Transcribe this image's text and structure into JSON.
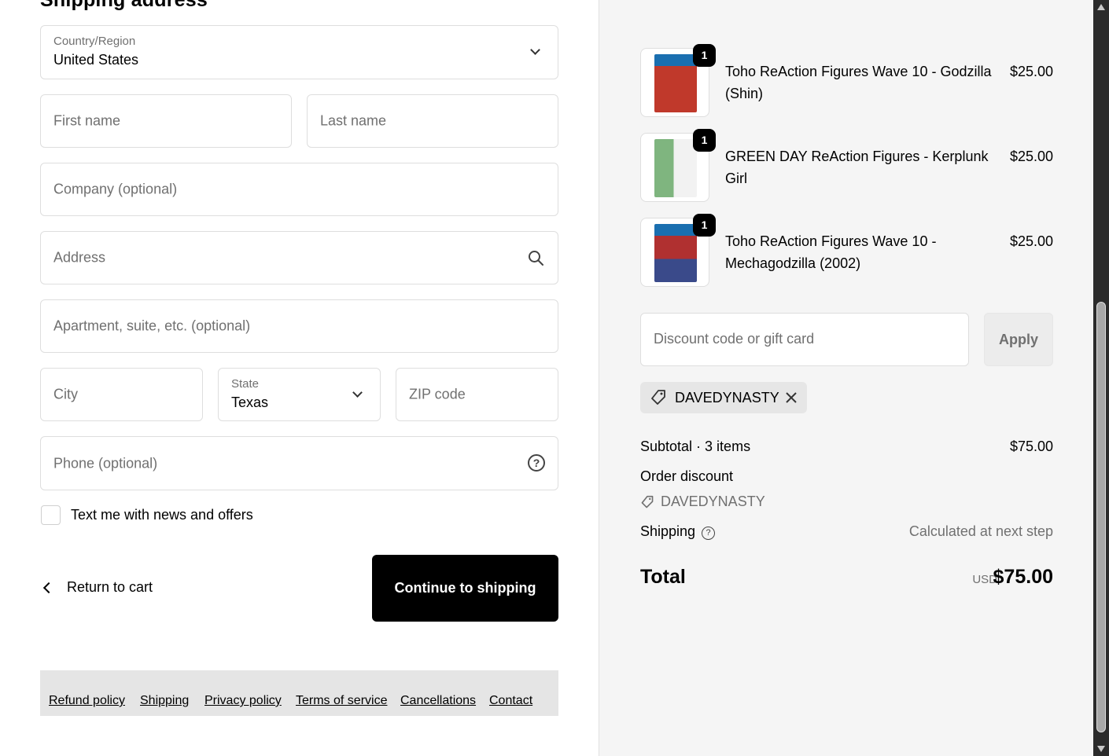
{
  "shipping": {
    "title": "Shipping address",
    "country_label": "Country/Region",
    "country_value": "United States",
    "first_name_placeholder": "First name",
    "last_name_placeholder": "Last name",
    "company_placeholder": "Company (optional)",
    "address_placeholder": "Address",
    "apartment_placeholder": "Apartment, suite, etc. (optional)",
    "city_placeholder": "City",
    "state_label": "State",
    "state_value": "Texas",
    "zip_placeholder": "ZIP code",
    "phone_placeholder": "Phone (optional)",
    "newsletter_label": "Text me with news and offers",
    "newsletter_checked": false
  },
  "actions": {
    "return_label": "Return to cart",
    "continue_label": "Continue to shipping"
  },
  "footer": {
    "links": [
      "Refund policy",
      "Shipping",
      "Privacy policy",
      "Terms of service",
      "Cancellations",
      "Contact"
    ]
  },
  "cart": {
    "items": [
      {
        "name": "Toho ReAction Figures Wave 10 - Godzilla (Shin)",
        "price": "$25.00",
        "qty": "1",
        "thumb_color": "#c0392b"
      },
      {
        "name": "GREEN DAY ReAction Figures - Kerplunk Girl",
        "price": "$25.00",
        "qty": "1",
        "thumb_color": "#8fbf8f"
      },
      {
        "name": "Toho ReAction Figures Wave 10 - Mechagodzilla (2002)",
        "price": "$25.00",
        "qty": "1",
        "thumb_color": "#b03030"
      }
    ],
    "discount_placeholder": "Discount code or gift card",
    "apply_label": "Apply",
    "applied_code": "DAVEDYNASTY"
  },
  "summary": {
    "subtotal_label": "Subtotal · 3 items",
    "subtotal_value": "$75.00",
    "order_discount_label": "Order discount",
    "discount_code": "DAVEDYNASTY",
    "shipping_label": "Shipping",
    "shipping_value": "Calculated at next step",
    "total_label": "Total",
    "currency": "USD",
    "total_value": "$75.00"
  },
  "icons": {
    "country_chevron": "chevron-down-icon",
    "state_chevron": "chevron-down-icon",
    "address_search": "search-icon",
    "phone_help": "help-icon",
    "return_arrow": "chevron-left-icon",
    "tag": "tag-icon",
    "remove_code": "close-icon"
  }
}
